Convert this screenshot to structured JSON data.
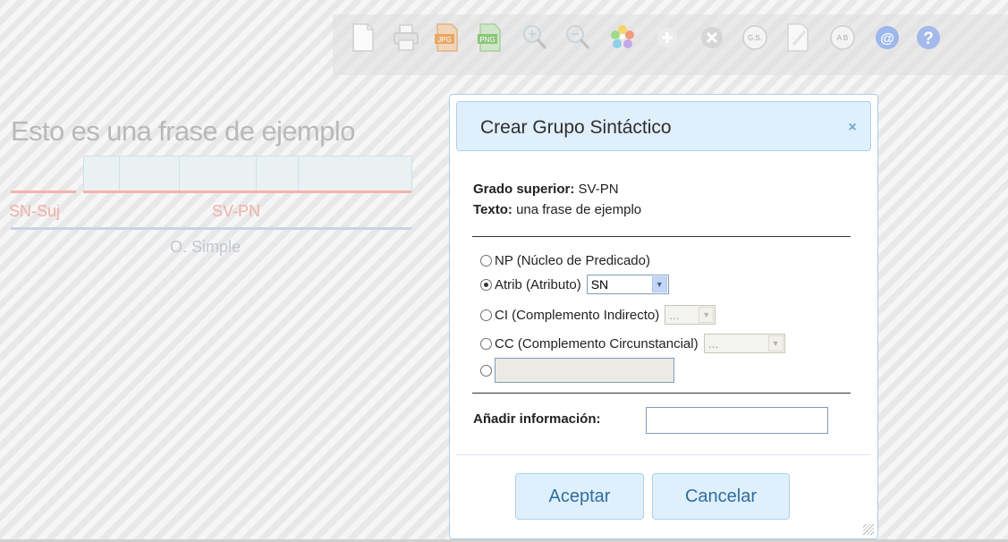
{
  "toolbar": {
    "icons": [
      "new-document-icon",
      "print-icon",
      "export-jpg-icon",
      "export-png-icon",
      "zoom-in-icon",
      "zoom-out-icon",
      "color-palette-icon",
      "add-icon",
      "delete-icon",
      "grupo-sintactico-icon",
      "edit-icon",
      "ab-icon",
      "email-icon",
      "help-icon"
    ],
    "jpg_label": "JPG",
    "png_label": "PNG",
    "gs_label": "G.S.",
    "ab_label": "A B",
    "at_label": "@",
    "help_label": "?"
  },
  "tree": {
    "sentence": "Esto es una frase de ejemplo",
    "sn_suj": "SN-Suj",
    "sv_pn": "SV-PN",
    "o_simple": "O. Simple"
  },
  "dialog": {
    "title": "Crear Grupo Sintáctico",
    "close_label": "×",
    "grado_label": "Grado superior:",
    "grado_value": "SV-PN",
    "texto_label": "Texto:",
    "texto_value": "una frase de ejemplo",
    "options": [
      {
        "label": "NP (Núcleo de Predicado)",
        "checked": false
      },
      {
        "label": "Atrib (Atributo)",
        "checked": true,
        "select": "SN"
      },
      {
        "label": "CI (Complemento Indirecto)",
        "checked": false,
        "select": "..."
      },
      {
        "label": "CC (Complemento Circunstancial)",
        "checked": false,
        "select": "..."
      },
      {
        "label": "",
        "checked": false
      }
    ],
    "add_info_label": "Añadir información:",
    "add_info_value": "",
    "accept_label": "Aceptar",
    "cancel_label": "Cancelar"
  },
  "colors": {
    "accent": "#2e6e9e",
    "titlebar": "#dfeffc",
    "border": "#aed0ea"
  }
}
